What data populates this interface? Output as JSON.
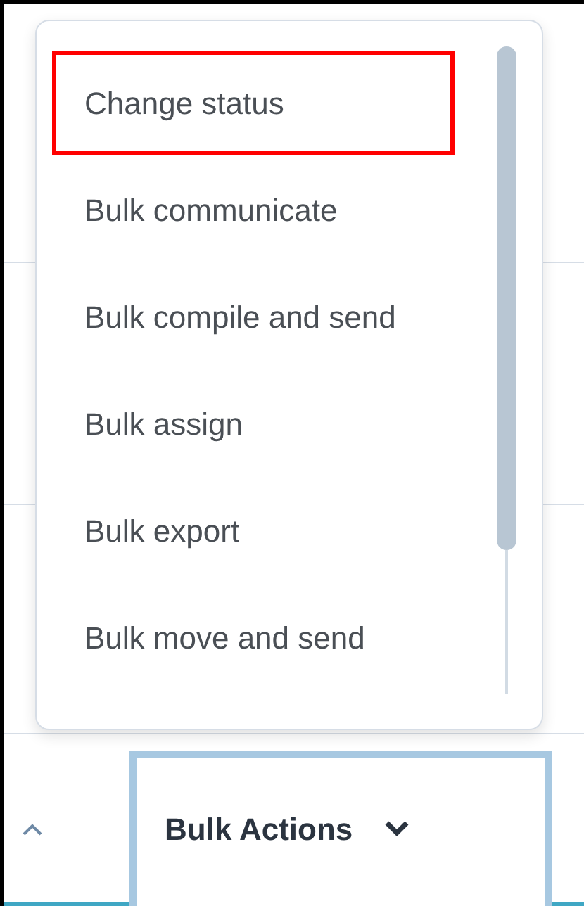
{
  "menu": {
    "items": [
      {
        "label": "Change status",
        "highlighted": true
      },
      {
        "label": "Bulk communicate",
        "highlighted": false
      },
      {
        "label": "Bulk compile and send",
        "highlighted": false
      },
      {
        "label": "Bulk assign",
        "highlighted": false
      },
      {
        "label": "Bulk export",
        "highlighted": false
      },
      {
        "label": "Bulk move and send",
        "highlighted": false
      }
    ]
  },
  "bulk_actions_button": {
    "label": "Bulk Actions"
  }
}
